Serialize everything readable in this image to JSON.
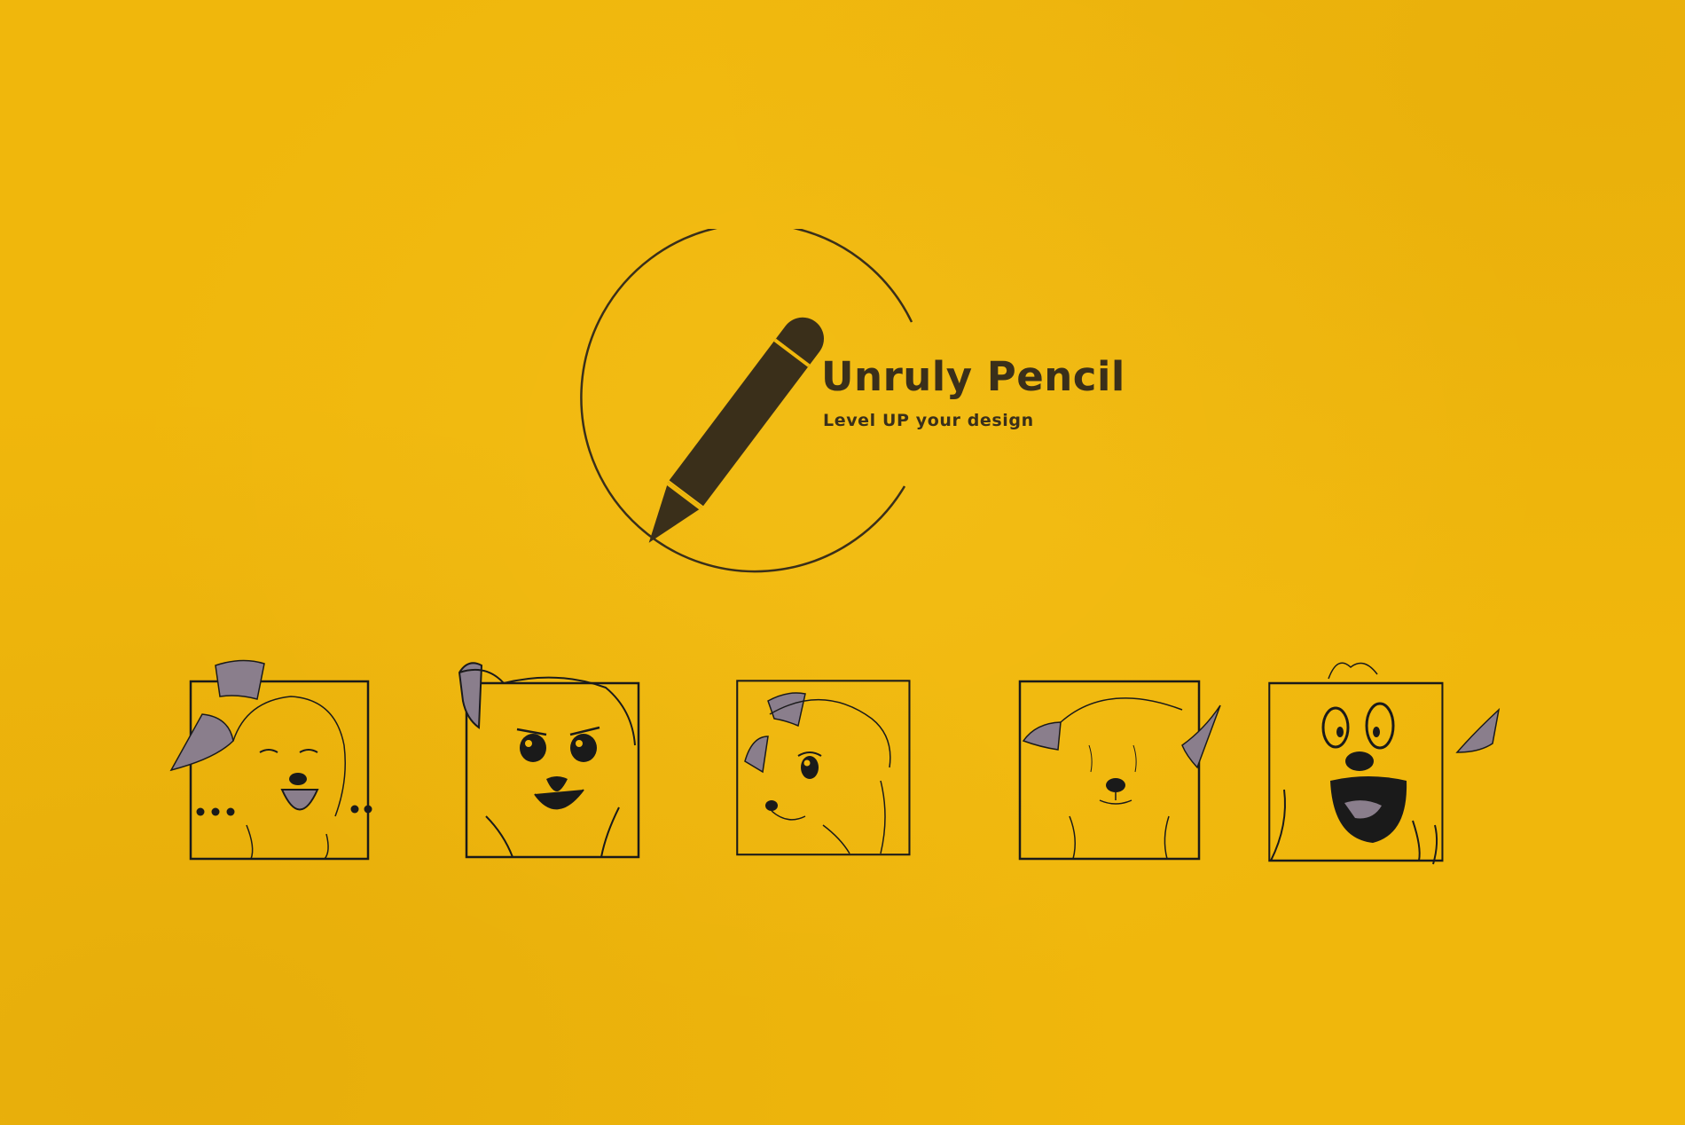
{
  "brand": {
    "name": "Unruly Pencil",
    "tagline": "Level UP your design"
  },
  "colors": {
    "background": "#f0b70c",
    "ink": "#3a2f1a",
    "ear_fill": "#8a7e8c"
  },
  "panels": [
    {
      "expression": "happy-eyes-closed"
    },
    {
      "expression": "determined"
    },
    {
      "expression": "side-glance"
    },
    {
      "expression": "blank-stare"
    },
    {
      "expression": "shocked"
    }
  ],
  "icons": [
    "pencil-icon",
    "logo-ring"
  ]
}
